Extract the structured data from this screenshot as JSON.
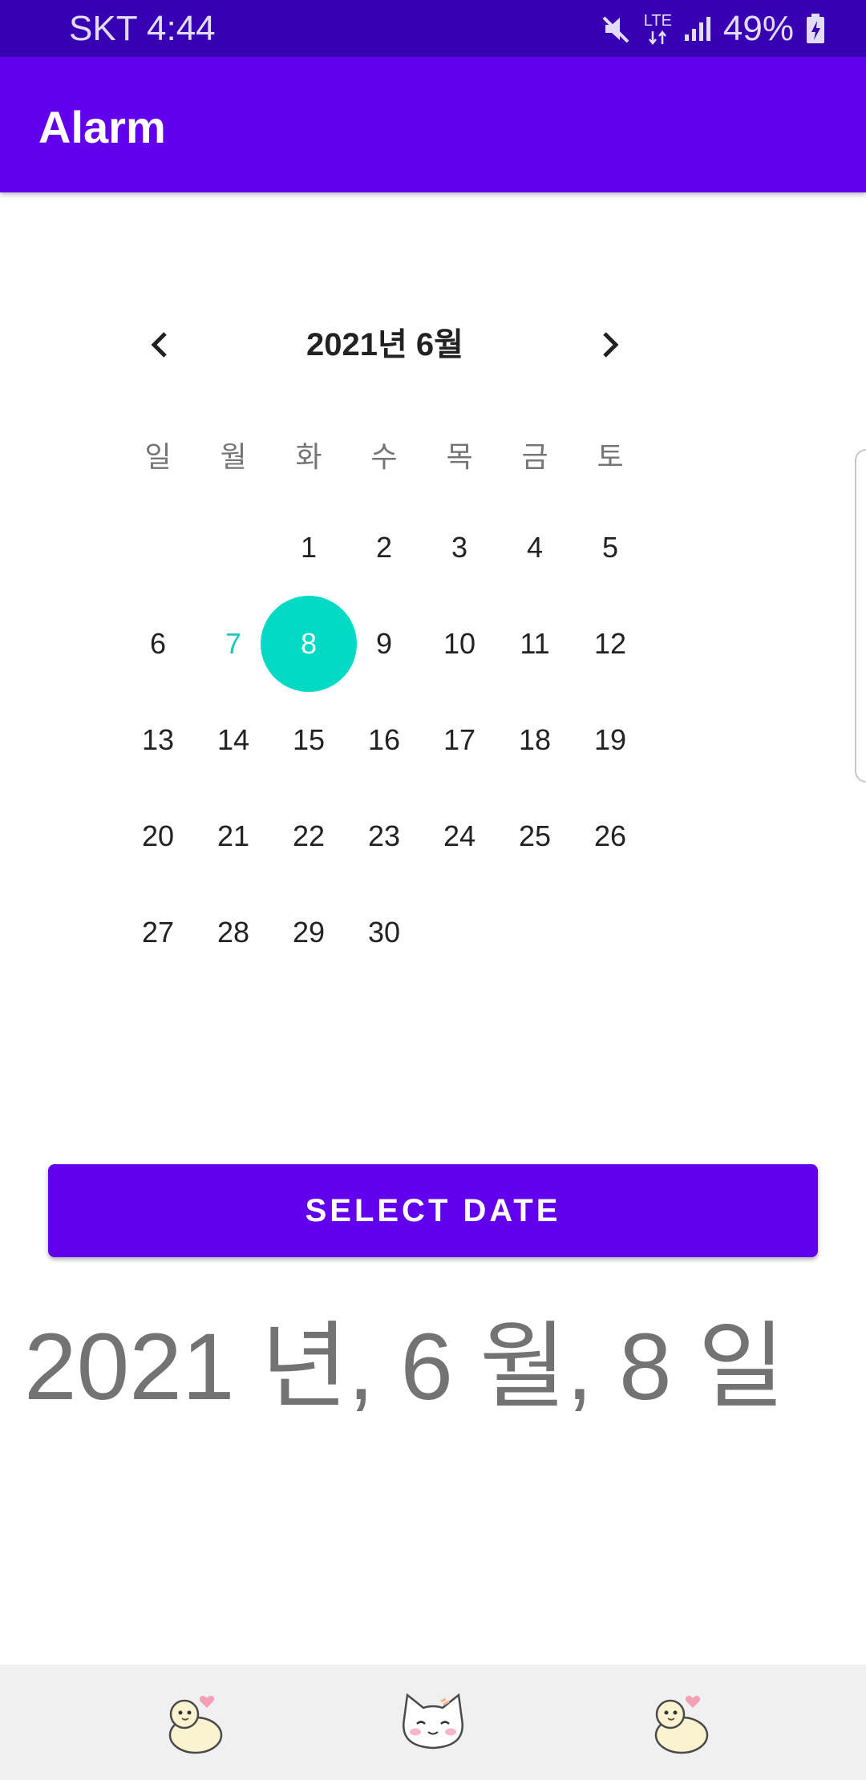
{
  "status_bar": {
    "carrier_time": "SKT 4:44",
    "network": "LTE",
    "battery": "49%",
    "icons": [
      "mute-icon",
      "lte-icon",
      "signal-icon",
      "battery-icon"
    ]
  },
  "app_bar": {
    "title": "Alarm"
  },
  "calendar": {
    "month_label": "2021년 6월",
    "weekdays": [
      "일",
      "월",
      "화",
      "수",
      "목",
      "금",
      "토"
    ],
    "days": [
      "1",
      "2",
      "3",
      "4",
      "5",
      "6",
      "7",
      "8",
      "9",
      "10",
      "11",
      "12",
      "13",
      "14",
      "15",
      "16",
      "17",
      "18",
      "19",
      "20",
      "21",
      "22",
      "23",
      "24",
      "25",
      "26",
      "27",
      "28",
      "29",
      "30"
    ],
    "first_weekday_index": 2,
    "today": "7",
    "selected": "8",
    "colors": {
      "selected_bg": "#03dac5",
      "today_text": "#1ec8c0"
    }
  },
  "select_button": {
    "label": "SELECT DATE"
  },
  "result": {
    "text": "2021 년, 6 월, 8 일"
  },
  "bottom_bar": {
    "icons": [
      "duck-icon",
      "cat-icon",
      "duck-icon"
    ]
  },
  "colors": {
    "primary": "#6200ee",
    "primary_dark": "#3700b3",
    "accent": "#03dac5"
  }
}
